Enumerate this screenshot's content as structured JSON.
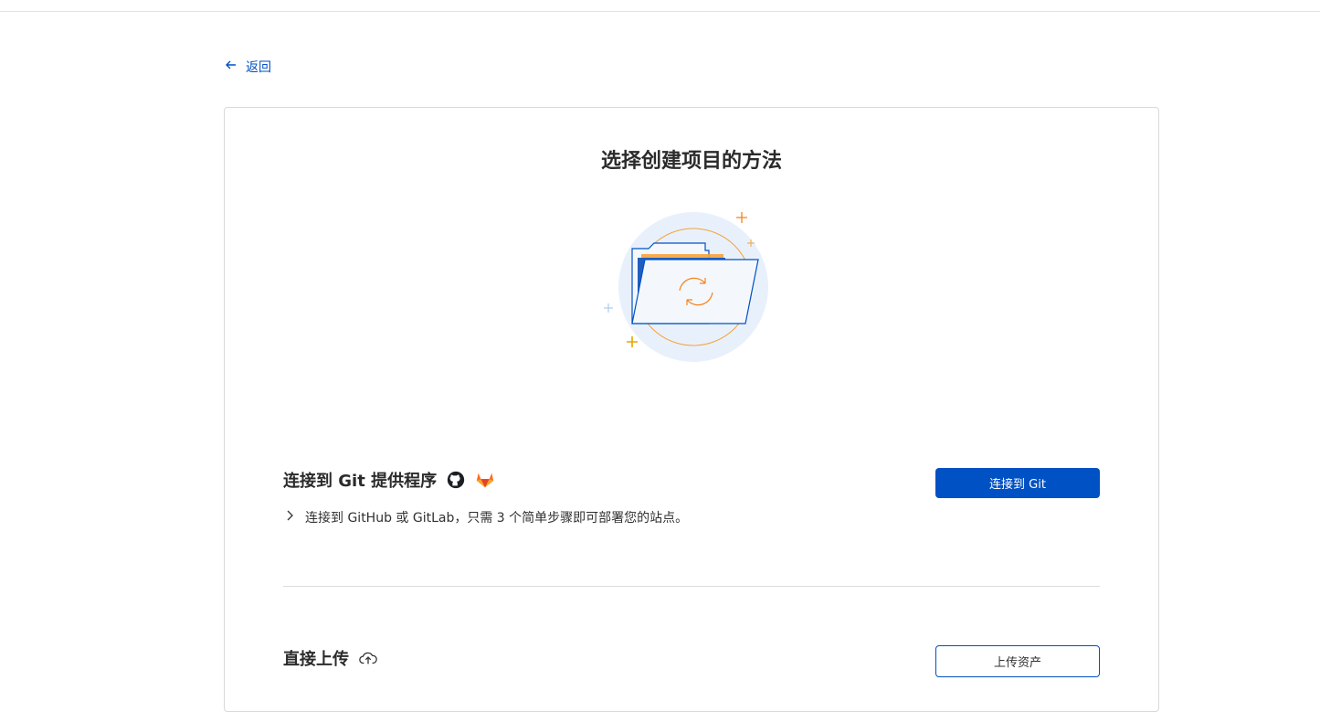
{
  "nav": {
    "back_label": "返回"
  },
  "page": {
    "title": "选择创建项目的方法"
  },
  "git_section": {
    "title": "连接到 Git 提供程序",
    "icons": [
      "github-icon",
      "gitlab-icon"
    ],
    "description": "连接到 GitHub 或 GitLab，只需 3 个简单步骤即可部署您的站点。",
    "button_label": "连接到 Git"
  },
  "upload_section": {
    "title": "直接上传",
    "icon": "cloud-upload-icon",
    "button_label": "上传资产"
  },
  "colors": {
    "accent": "#0051c3",
    "orange": "#f6821f",
    "hero_bg": "#e8f1fb"
  }
}
